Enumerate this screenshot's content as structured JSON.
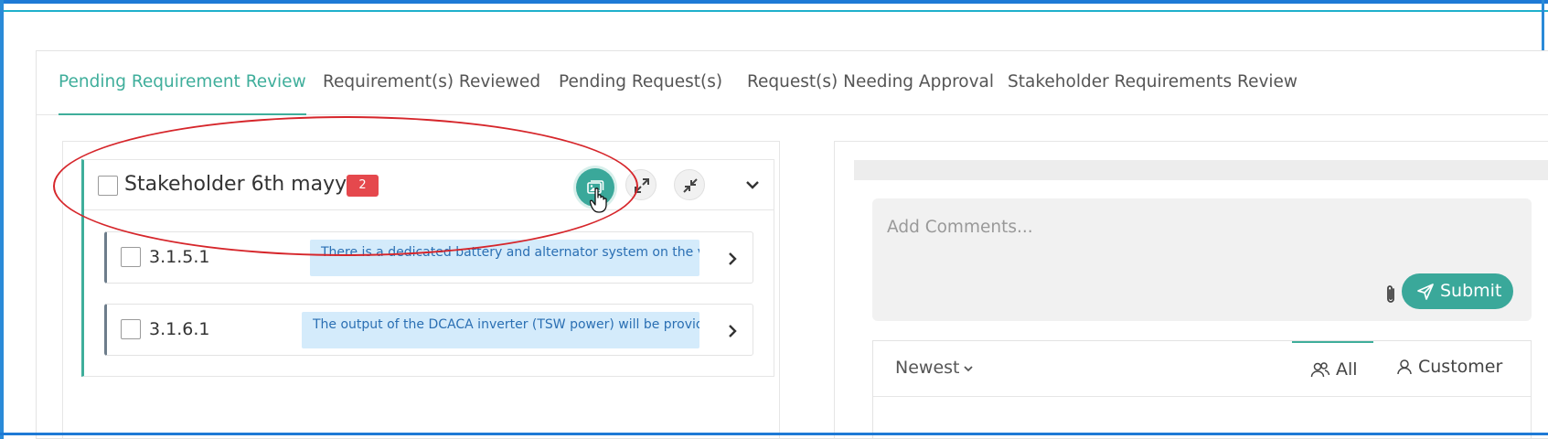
{
  "tabs": [
    {
      "label": "Pending Requirement Review",
      "active": true
    },
    {
      "label": "Requirement(s) Reviewed",
      "active": false
    },
    {
      "label": "Pending Request(s)",
      "active": false
    },
    {
      "label": "Request(s) Needing Approval",
      "active": false
    },
    {
      "label": "Stakeholder Requirements Review",
      "active": false
    }
  ],
  "group": {
    "title": "Stakeholder 6th mayy",
    "count": "2",
    "icons": {
      "image": "image-gallery-icon",
      "expand": "expand-icon",
      "collapse": "collapse-icon",
      "toggle": "chevron-down-icon"
    }
  },
  "requirements": [
    {
      "id": "3.1.5.1",
      "text": "There is a dedicated battery and alternator system on the ve"
    },
    {
      "id": "3.1.6.1",
      "text": "The output of the DCACA inverter (TSW power) will be provide"
    }
  ],
  "comments": {
    "placeholder": "Add Comments...",
    "submit_label": "Submit",
    "attach_icon": "paperclip-icon"
  },
  "feed": {
    "sort_label": "Newest",
    "filters": [
      {
        "label": "All",
        "icon": "users-icon",
        "active": true
      },
      {
        "label": "Customer",
        "icon": "user-icon",
        "active": false
      }
    ]
  },
  "colors": {
    "accent": "#3fae9b",
    "badge": "#e5484d",
    "highlight_bg": "#d4ebfb",
    "annotation": "#d6262b"
  }
}
